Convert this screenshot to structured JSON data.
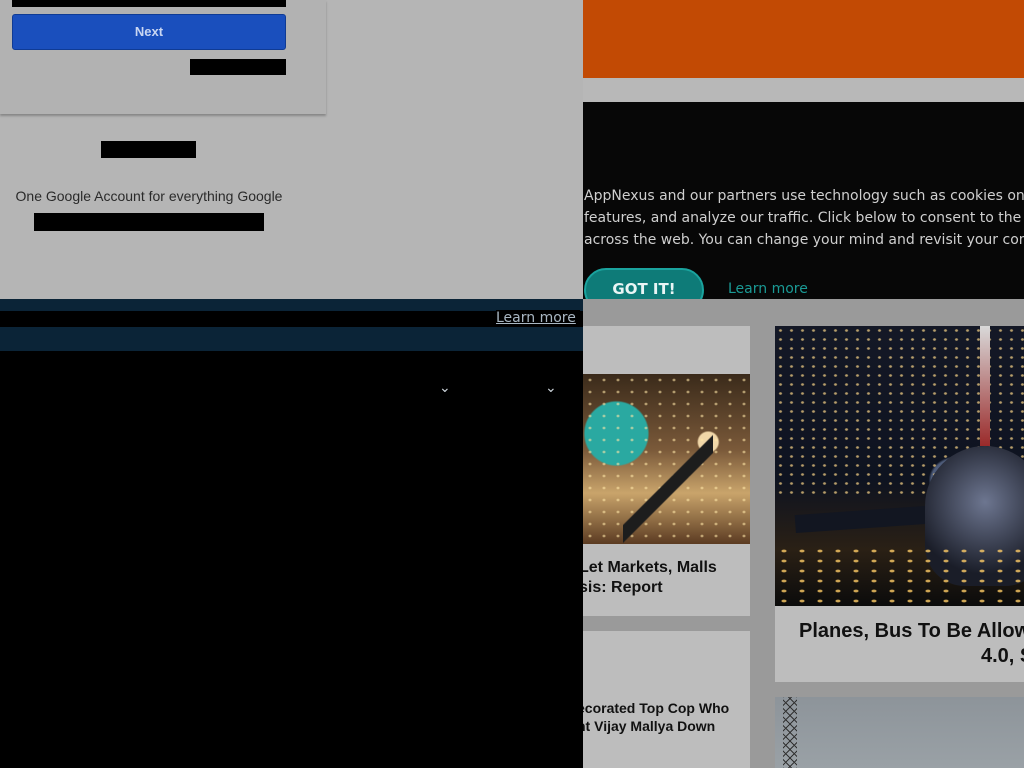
{
  "signin": {
    "next_label": "Next",
    "tagline": "One Google Account for everything Google"
  },
  "cookie_strip": {
    "learn_more": "Learn more",
    "chevron": "⌄"
  },
  "consent": {
    "line1": "AppNexus and our partners use technology such as cookies on our sit",
    "line2": "features, and analyze our traffic. Click below to consent to the use of t",
    "line3": "across the web. You can change your mind and revisit your consent ch",
    "got_it": "GOT IT!",
    "learn_more": "Learn more"
  },
  "news": {
    "card1_title_1": "Let Markets, Malls",
    "card1_title_2": "sis: Report",
    "card2_title_1": "Planes, Bus To Be Allow",
    "card2_title_2": "4.0, S",
    "card3_title_1": "ecorated Top Cop Who",
    "card3_title_2": "ht Vijay Mallya Down"
  },
  "colors": {
    "header_orange": "#c24a04",
    "next_blue": "#1a4fbd",
    "consent_teal": "#0e7b78"
  }
}
